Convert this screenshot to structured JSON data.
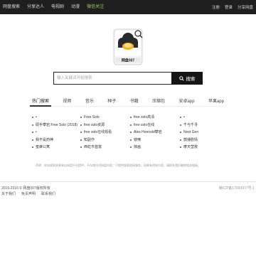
{
  "topnav": {
    "items": [
      "网盘搜索",
      "分享达人",
      "电视剧",
      "动漫",
      "微信关注"
    ]
  },
  "toplinks": [
    "注册",
    "登录",
    "分享网盘"
  ],
  "logo": {
    "text": "网盘007"
  },
  "search": {
    "placeholder": "输入关键词开始搜索",
    "button_label": "搜索"
  },
  "tabs": [
    "热门搜索",
    "视频",
    "音乐",
    "种子",
    "书籍",
    "压缩包",
    "安卓app",
    "苹果app"
  ],
  "results": [
    [
      "•",
      "Free Solo",
      "free solo高清",
      "•"
    ],
    [
      "硕手攀岩 Free Solo (2018)",
      "free solo资源",
      "free solo在线",
      "千与千寻"
    ],
    [
      "•",
      "free solo在线观看",
      "Alex Honnold攀岩",
      "Next Gen"
    ],
    [
      "我不是药神",
      "知副作",
      "镜嘀",
      "鼓播剧情"
    ],
    [
      "蜜蜂公寓",
      "西虹市首富",
      "抹画",
      "摩天营救"
    ]
  ],
  "notice": "声明：本站搜索结果来自网盘平台提供，不存储任何网盘内容；只提供搜索链接服务，如果有侵权内容，请联系我们删除相关链接。",
  "footer": {
    "copyright": "2015-2016 © 网盘007版权所有",
    "links": [
      "关于我们",
      "免责声明",
      "联系我们"
    ],
    "icp": "赣ICP备17033977号-1"
  },
  "colors": {
    "topbar": "#1f1f1f",
    "accent": "#9ad06f",
    "button": "#151515"
  }
}
